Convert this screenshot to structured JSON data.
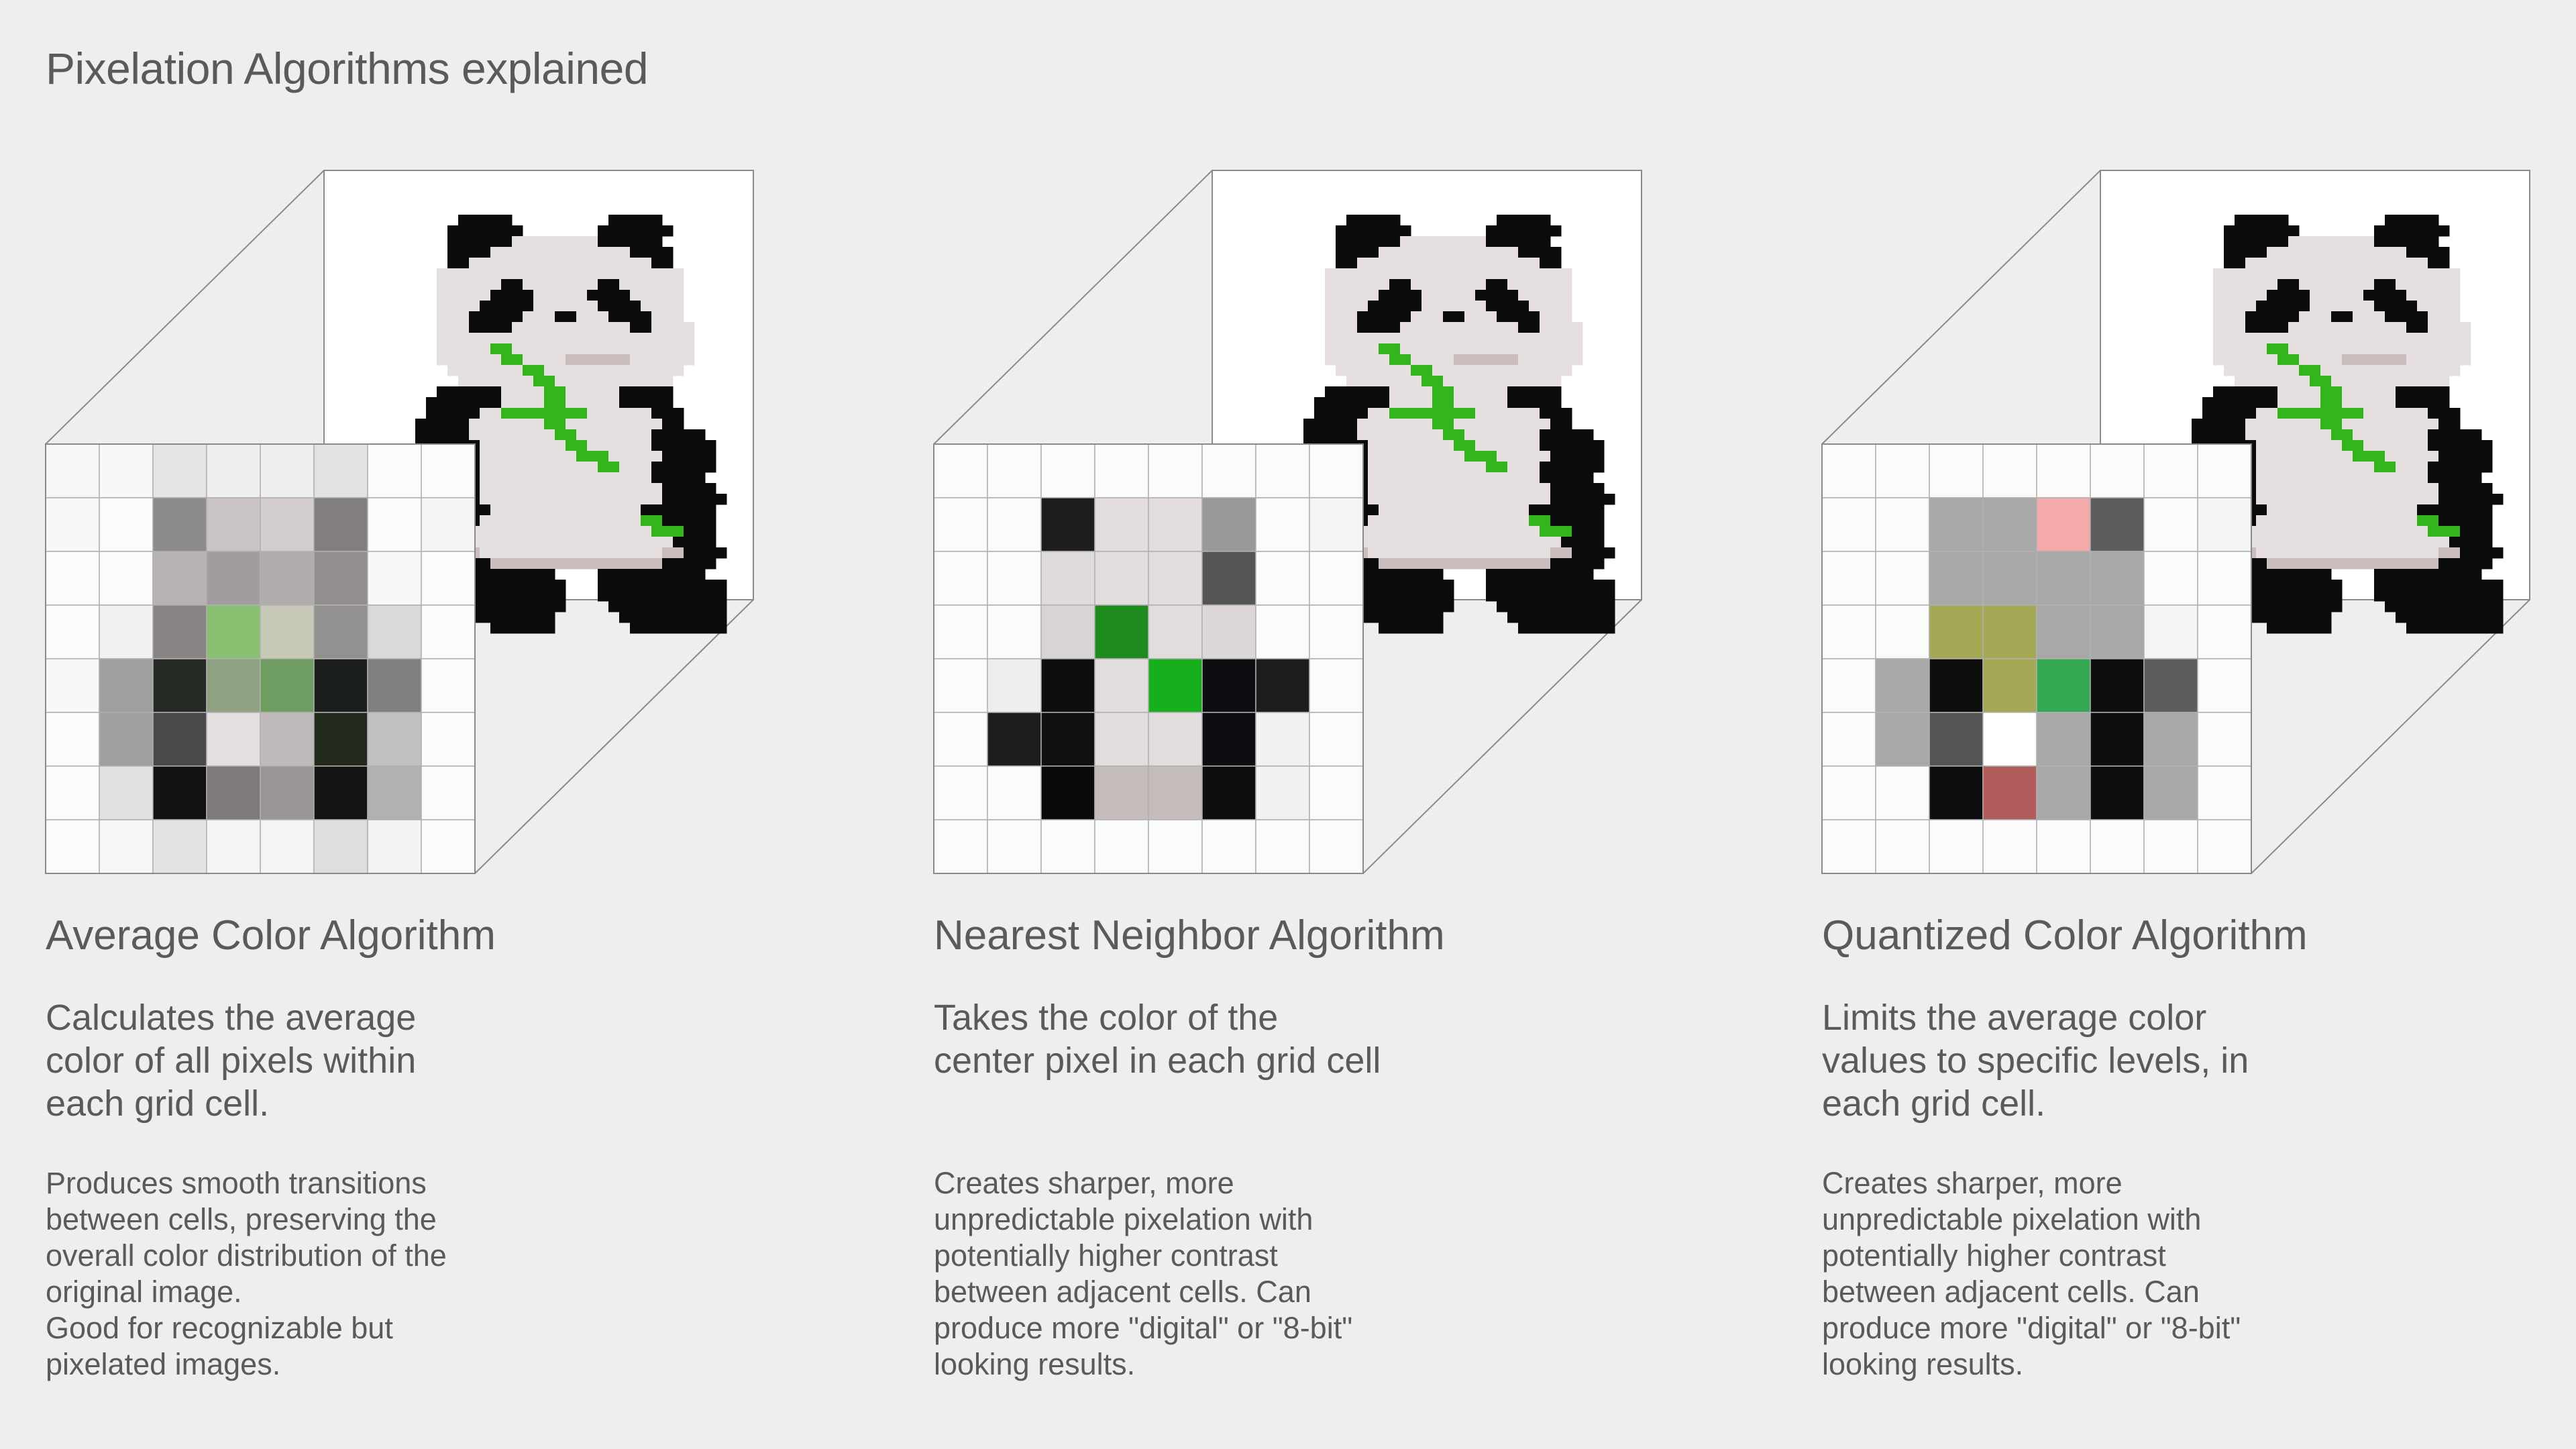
{
  "page": {
    "title": "Pixelation Algorithms explained",
    "background": "#eeeeee",
    "text_color": "#5a5a5a"
  },
  "panda_palette": {
    "black": "#0b0b0b",
    "white_fur": "#e6dfdf",
    "shadow_fur": "#c9bdbd",
    "bamboo": "#33b51c",
    "background": "#ffffff"
  },
  "algorithms": [
    {
      "title": "Average Color Algorithm",
      "summary_lines": [
        "Calculates the average",
        "color of all pixels within",
        "each grid cell."
      ],
      "detail_lines": [
        "Produces smooth transitions",
        "between cells, preserving the",
        "overall color distribution of the",
        "original image.",
        "Good for recognizable but",
        "pixelated images."
      ],
      "grid": [
        [
          "#f6f6f6",
          "#f8f8f8",
          "#e4e4e4",
          "#efefef",
          "#efefef",
          "#e2e2e2",
          "#fbfbfb",
          "#fbfbfb"
        ],
        [
          "#f8f8f8",
          "#fbfbfb",
          "#8c8a8a",
          "#c9c3c3",
          "#d3cdcd",
          "#817e7d",
          "#fbfbfb",
          "#f4f4f4"
        ],
        [
          "#fbfbfb",
          "#fbfbfb",
          "#b8b3b3",
          "#a19d9c",
          "#b1adad",
          "#938f8f",
          "#f8f8f8",
          "#fbfbfb"
        ],
        [
          "#fbfbfb",
          "#f1f1f1",
          "#878483",
          "#88c072",
          "#c7c8b6",
          "#939090",
          "#d9d9d9",
          "#fbfbfb"
        ],
        [
          "#f8f8f8",
          "#9f9f9f",
          "#252a24",
          "#8ea282",
          "#6f9c61",
          "#1b1f1b",
          "#7f7f7f",
          "#fbfbfb"
        ],
        [
          "#fbfbfb",
          "#a0a0a0",
          "#4a4949",
          "#e3dfdf",
          "#bfb9b9",
          "#222a1d",
          "#c1c1c1",
          "#fbfbfb"
        ],
        [
          "#fbfbfb",
          "#e1e1e1",
          "#111111",
          "#7e7a7a",
          "#999595",
          "#141414",
          "#b1b1b1",
          "#fbfbfb"
        ],
        [
          "#fbfbfb",
          "#f6f6f6",
          "#e3e3e3",
          "#f4f4f4",
          "#f4f4f4",
          "#dedede",
          "#f3f3f3",
          "#fbfbfb"
        ]
      ]
    },
    {
      "title": "Nearest Neighbor Algorithm",
      "summary_lines": [
        "Takes the color of the",
        "center pixel in each grid cell"
      ],
      "detail_lines": [
        "Creates sharper, more",
        "unpredictable pixelation with",
        "potentially higher contrast",
        "between adjacent cells. Can",
        "produce more \"digital\" or \"8-bit\"",
        "looking results."
      ],
      "grid": [
        [
          "#fbfbfb",
          "#fbfbfb",
          "#fbfbfb",
          "#fbfbfb",
          "#fbfbfb",
          "#fbfbfb",
          "#fbfbfb",
          "#fbfbfb"
        ],
        [
          "#fbfbfb",
          "#fbfbfb",
          "#1e1e1e",
          "#e3dcdc",
          "#e3dcdc",
          "#9a9898",
          "#fbfbfb",
          "#f4f4f4"
        ],
        [
          "#fbfbfb",
          "#fbfbfb",
          "#e0dbdb",
          "#e3dcdc",
          "#e3dcdc",
          "#555555",
          "#fbfbfb",
          "#fbfbfb"
        ],
        [
          "#fbfbfb",
          "#fbfbfb",
          "#d8d4d4",
          "#1e8b1e",
          "#e3dcdc",
          "#dcd6d6",
          "#fbfbfb",
          "#fbfbfb"
        ],
        [
          "#fbfbfb",
          "#eeeeee",
          "#0e0e0e",
          "#e3dcdc",
          "#17b01c",
          "#0e0e12",
          "#1e1e1e",
          "#fbfbfb"
        ],
        [
          "#fbfbfb",
          "#1e1e1e",
          "#101010",
          "#e3dcdc",
          "#e3dcdc",
          "#0e0e12",
          "#f1f1f1",
          "#fbfbfb"
        ],
        [
          "#fbfbfb",
          "#fbfbfb",
          "#0a0a0a",
          "#c5bcbc",
          "#c5bcbc",
          "#0e0e0e",
          "#f1f1f1",
          "#fbfbfb"
        ],
        [
          "#fbfbfb",
          "#fbfbfb",
          "#fbfbfb",
          "#fbfbfb",
          "#fbfbfb",
          "#fbfbfb",
          "#fbfbfb",
          "#fbfbfb"
        ]
      ]
    },
    {
      "title": "Quantized Color Algorithm",
      "summary_lines": [
        "Limits the average color",
        "values to specific levels, in",
        "each grid cell."
      ],
      "detail_lines": [
        "Creates sharper, more",
        "unpredictable pixelation with",
        "potentially higher contrast",
        "between adjacent cells. Can",
        "produce more \"digital\" or \"8-bit\"",
        "looking results."
      ],
      "grid": [
        [
          "#fbfbfb",
          "#fbfbfb",
          "#fbfbfb",
          "#fbfbfb",
          "#fbfbfb",
          "#fbfbfb",
          "#fbfbfb",
          "#fbfbfb"
        ],
        [
          "#fbfbfb",
          "#fbfbfb",
          "#a8a8a8",
          "#a8a8a8",
          "#f4aaaa",
          "#5d5d5d",
          "#fbfbfb",
          "#f4f4f4"
        ],
        [
          "#fbfbfb",
          "#fbfbfb",
          "#a8a8a8",
          "#a8a8a8",
          "#a8a8a8",
          "#a8a8a8",
          "#fbfbfb",
          "#fbfbfb"
        ],
        [
          "#fbfbfb",
          "#fbfbfb",
          "#a5a855",
          "#a5a855",
          "#a8a8a8",
          "#a8a8a8",
          "#f4f4f4",
          "#fbfbfb"
        ],
        [
          "#fbfbfb",
          "#a8a8a8",
          "#0e0e0e",
          "#a5a855",
          "#34a853",
          "#0e0e0e",
          "#5d5d5d",
          "#fbfbfb"
        ],
        [
          "#fbfbfb",
          "#a8a8a8",
          "#555555",
          "#ffffff",
          "#a8a8a8",
          "#0e0e0e",
          "#a8a8a8",
          "#fbfbfb"
        ],
        [
          "#fbfbfb",
          "#fbfbfb",
          "#0e0e0e",
          "#b15b5b",
          "#a8a8a8",
          "#0e0e0e",
          "#a8a8a8",
          "#fbfbfb"
        ],
        [
          "#fbfbfb",
          "#fbfbfb",
          "#fbfbfb",
          "#fbfbfb",
          "#fbfbfb",
          "#fbfbfb",
          "#fbfbfb",
          "#fbfbfb"
        ]
      ]
    }
  ]
}
